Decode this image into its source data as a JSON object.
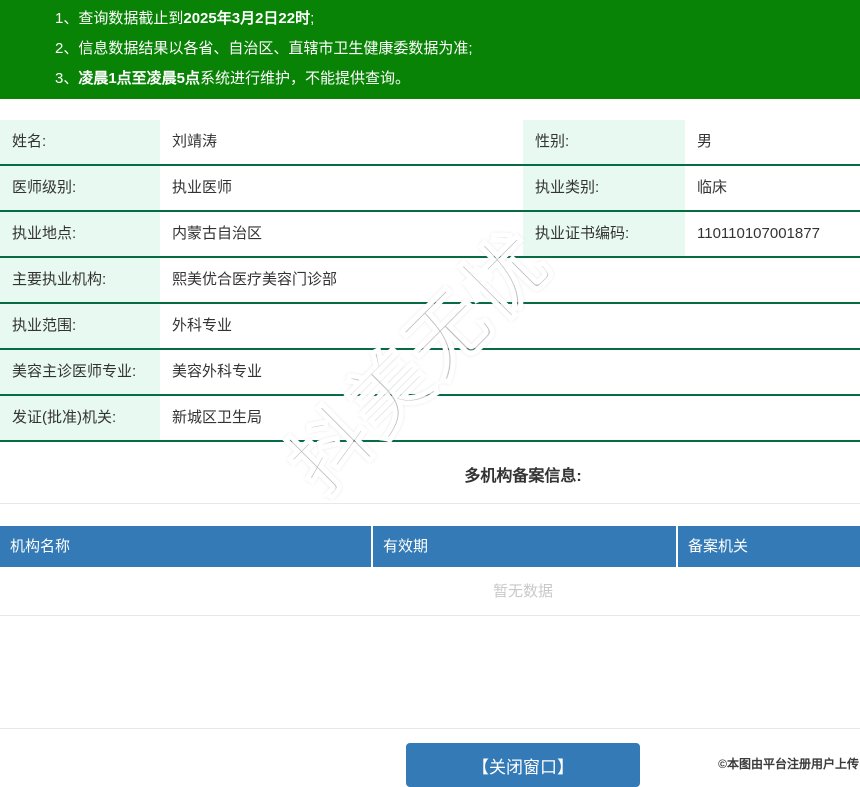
{
  "notice": {
    "items": [
      {
        "num": "1、",
        "normal1": "查询数据截止到",
        "bold": "2025年3月2日22时",
        "normal2": ";"
      },
      {
        "num": "2、",
        "normal1": "信息数据结果以各省、自治区、直辖市卫生健康委数据为准;",
        "bold": "",
        "normal2": ""
      },
      {
        "num": "3、",
        "normal1": "",
        "bold": "凌晨1点至凌晨5点",
        "normal2": "系统进行维护，不能提供查询。"
      }
    ]
  },
  "fields": [
    {
      "label": "姓名:",
      "value": "刘靖涛",
      "label2": "性别:",
      "value2": "男"
    },
    {
      "label": "医师级别:",
      "value": "执业医师",
      "label2": "执业类别:",
      "value2": "临床"
    },
    {
      "label": "执业地点:",
      "value": "内蒙古自治区",
      "label2": "执业证书编码:",
      "value2": "110110107001877"
    },
    {
      "label": "主要执业机构:",
      "value": "熙美优合医疗美容门诊部"
    },
    {
      "label": "执业范围:",
      "value": "外科专业"
    },
    {
      "label": "美容主诊医师专业:",
      "value": "美容外科专业"
    },
    {
      "label": "发证(批准)机关:",
      "value": "新城区卫生局"
    }
  ],
  "registration": {
    "title": "多机构备案信息:",
    "columns": [
      "机构名称",
      "有效期",
      "备案机关"
    ],
    "empty_text": "暂无数据"
  },
  "watermark": {
    "text": "抖美无忧"
  },
  "footer": {
    "close_button": "【关闭窗口】",
    "copyright": "©本图由平台注册用户上传"
  },
  "colors": {
    "banner_green": "#098306",
    "row_separator_green": "#076b44",
    "label_bg_mint": "#e8f9f1",
    "table_header_blue": "#337ab7",
    "button_blue": "#337ab7"
  }
}
